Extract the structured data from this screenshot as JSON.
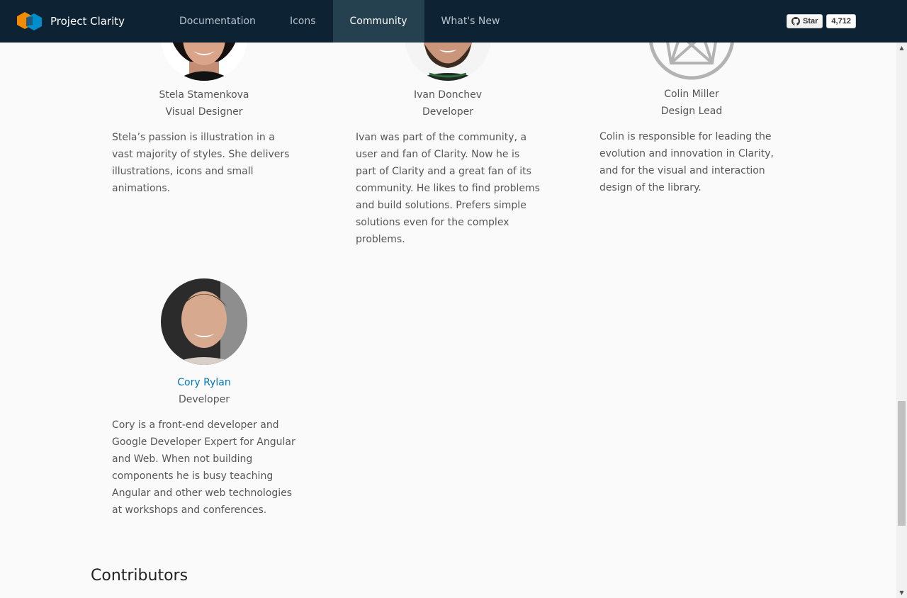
{
  "header": {
    "brand": "Project Clarity",
    "nav": [
      "Documentation",
      "Icons",
      "Community",
      "What's New"
    ],
    "active_nav": "Community",
    "github": {
      "star_label": "Star",
      "count": "4,712"
    }
  },
  "people": [
    {
      "name": "Stela Stamenkova",
      "role": "Visual Designer",
      "bio": "Stela’s passion is illustration in a vast majority of styles. She delivers illustrations, icons and small animations."
    },
    {
      "name": "Ivan Donchev",
      "role": "Developer",
      "bio": "Ivan was part of the community, a user and fan of Clarity. Now he is part of Clarity and a great fan of its community. He likes to find problems and build solutions. Prefers simple solutions even for the complex problems."
    },
    {
      "name": "Colin Miller",
      "role": "Design Lead",
      "bio": "Colin is responsible for leading the evolution and innovation in Clarity, and for the visual and interaction design of the library."
    },
    {
      "name": "Cory Rylan",
      "role": "Developer",
      "bio": "Cory is a front-end developer and Google Developer Expert for Angular and Web. When not building components he is busy teaching Angular and other web technologies at workshops and conferences."
    }
  ],
  "contributors_heading": "Contributors",
  "colors": {
    "header_bg": "#0d2233",
    "active_nav_bg": "#25404f",
    "link": "#0079b8",
    "text": "#565656"
  }
}
